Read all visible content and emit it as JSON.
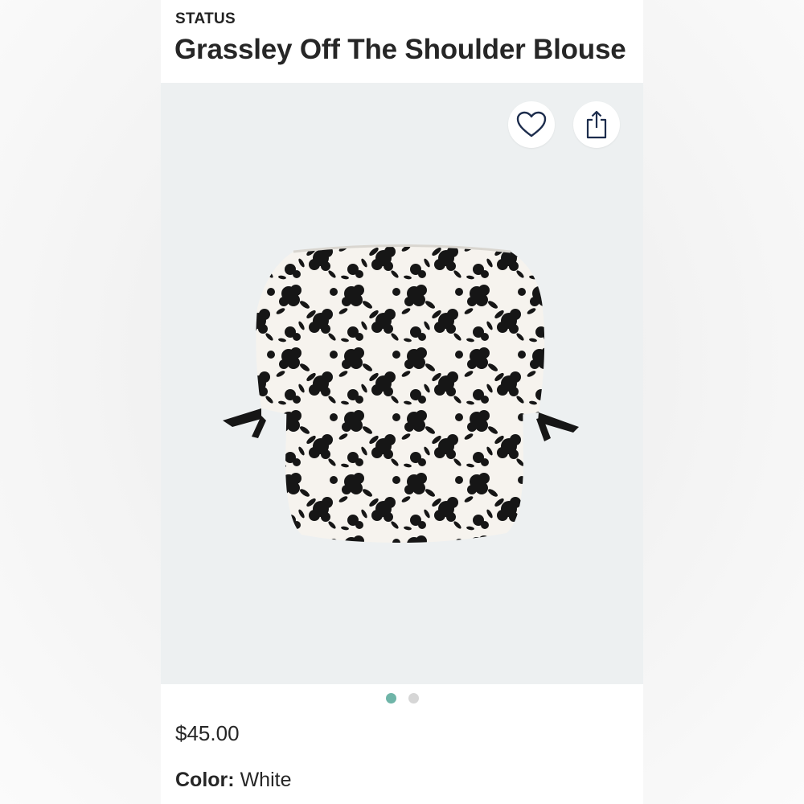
{
  "product": {
    "brand": "STATUS",
    "title": "Grassley Off The Shoulder Blouse",
    "price": "$45.00",
    "color_label": "Color:",
    "color_value": "White"
  },
  "gallery": {
    "image_count": 2,
    "active_index": 0,
    "favorite_icon": "heart-icon",
    "share_icon": "share-icon"
  },
  "colors": {
    "panel_bg": "#ffffff",
    "image_bg": "#edf0f1",
    "active_dot": "#6fb5a8",
    "inactive_dot": "#d6d6d6",
    "icon_navy": "#1c2c4c"
  }
}
